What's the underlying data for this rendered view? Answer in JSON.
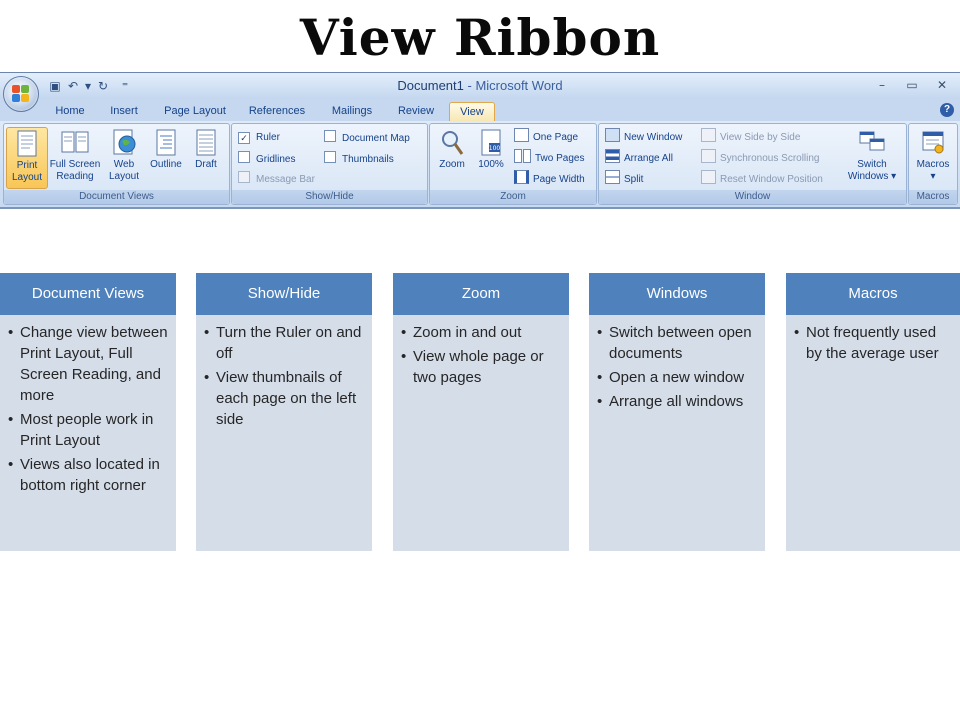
{
  "slide": {
    "title": "View Ribbon"
  },
  "window": {
    "doc_name": "Document1",
    "separator": " - ",
    "app_name": "Microsoft Word",
    "controls": {
      "minimize": "–",
      "restore": "▭",
      "close": "✕"
    },
    "help": "?"
  },
  "qat": [
    {
      "icon": "save-icon",
      "glyph": "▣"
    },
    {
      "icon": "undo-icon",
      "glyph": "↶"
    },
    {
      "icon": "dropdown-icon",
      "glyph": "▾"
    },
    {
      "icon": "redo-icon",
      "glyph": "↻"
    },
    {
      "icon": "customize-qat-icon",
      "glyph": "⁼"
    }
  ],
  "tabs": [
    "Home",
    "Insert",
    "Page Layout",
    "References",
    "Mailings",
    "Review",
    "View"
  ],
  "active_tab": "View",
  "groups": {
    "document_views": {
      "label": "Document Views",
      "buttons": [
        {
          "label1": "Print",
          "label2": "Layout",
          "icon": "print-layout-icon",
          "selected": true
        },
        {
          "label1": "Full Screen",
          "label2": "Reading",
          "icon": "full-screen-reading-icon"
        },
        {
          "label1": "Web",
          "label2": "Layout",
          "icon": "web-layout-icon"
        },
        {
          "label1": "Outline",
          "label2": "",
          "icon": "outline-icon"
        },
        {
          "label1": "Draft",
          "label2": "",
          "icon": "draft-icon"
        }
      ]
    },
    "show_hide": {
      "label": "Show/Hide",
      "items": [
        {
          "label": "Ruler",
          "checked": true,
          "disabled": false
        },
        {
          "label": "Gridlines",
          "checked": false,
          "disabled": false
        },
        {
          "label": "Message Bar",
          "checked": false,
          "disabled": true
        },
        {
          "label": "Document Map",
          "checked": false,
          "disabled": false
        },
        {
          "label": "Thumbnails",
          "checked": false,
          "disabled": false
        }
      ]
    },
    "zoom": {
      "label": "Zoom",
      "zoom_label": "Zoom",
      "hundred_label": "100%",
      "one_page": "One Page",
      "two_pages": "Two Pages",
      "page_width": "Page Width"
    },
    "window": {
      "label": "Window",
      "new_window": "New Window",
      "arrange_all": "Arrange All",
      "split": "Split",
      "view_side": "View Side by Side",
      "sync_scroll": "Synchronous Scrolling",
      "reset_pos": "Reset Window Position",
      "switch1": "Switch",
      "switch2": "Windows ▾"
    },
    "macros": {
      "label": "Macros",
      "btn": "Macros",
      "arrow": "▾"
    }
  },
  "boxes": [
    {
      "title": "Document Views",
      "bullets": [
        "Change view between Print Layout, Full Screen Reading, and more",
        "Most people work in Print Layout",
        "Views also located in bottom right corner"
      ]
    },
    {
      "title": "Show/Hide",
      "bullets": [
        "Turn the Ruler on and off",
        "View thumbnails of each page on the left side"
      ]
    },
    {
      "title": "Zoom",
      "bullets": [
        "Zoom in and out",
        "View whole page or two pages"
      ]
    },
    {
      "title": "Windows",
      "bullets": [
        "Switch between open documents",
        "Open a new window",
        "Arrange all windows"
      ]
    },
    {
      "title": "Macros",
      "bullets": [
        "Not frequently used by the average user"
      ]
    }
  ],
  "colors": {
    "box_header": "#4f81bd",
    "box_body": "#d5dde9",
    "ribbon_bg": "#c7daf1",
    "selected_button": "#f8c656",
    "tab_text": "#15428b"
  }
}
